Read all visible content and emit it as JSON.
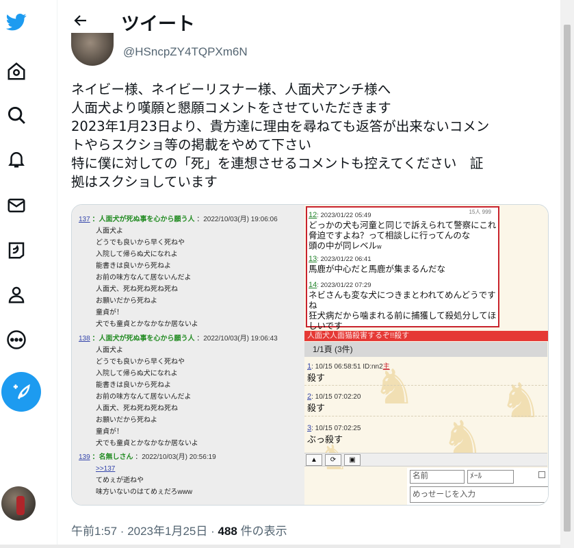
{
  "header": {
    "title": "ツイート"
  },
  "author": {
    "handle": "@HSncpZY4TQPXm6N"
  },
  "tweet": {
    "lines": [
      "ネイビー様、ネイビーリスナー様、人面犬アンチ様へ",
      "人面犬より嘆願と懇願コメントをさせていただきます",
      "2023年1月23日より、貴方達に理由を尋ねても返答が出来ないコメン",
      "トやらスクショ等の掲載をやめて下さい",
      "特に僕に対しての「死」を連想させるコメントも控えてください　証",
      "拠はスクショしています"
    ],
    "time": "午前1:57 · 2023年1月25日 · ",
    "views_count": "488",
    "views_label": " 件の表示"
  },
  "media": {
    "left_posts": [
      {
        "num": "137",
        "name": "：人面犬が死ぬ事を心から願う人",
        "date": "：2022/10/03(月) 19:06:06",
        "lines": [
          "人面犬よ",
          "どうでも良いから早く死ねや",
          "入院して帰らぬ犬になれよ",
          "能書きは良いから死ねよ",
          "お前の味方なんて居ないんだよ",
          "人面犬、死ね死ね死ね死ね",
          "お願いだから死ねよ",
          "童貞が！",
          "犬でも童貞とかなかなか居ないよ"
        ]
      },
      {
        "num": "138",
        "name": "：人面犬が死ぬ事を心から願う人",
        "date": "：2022/10/03(月) 19:06:43",
        "lines": [
          "人面犬よ",
          "どうでも良いから早く死ねや",
          "入院して帰らぬ犬になれよ",
          "能書きは良いから死ねよ",
          "お前の味方なんて居ないんだよ",
          "人面犬、死ね死ね死ね死ね",
          "お願いだから死ねよ",
          "童貞が！",
          "犬でも童貞とかなかなか居ないよ"
        ]
      },
      {
        "num": "139",
        "name": "：名無しさん",
        "date": "：2022/10/03(月) 20:56:19",
        "reply": ">>137",
        "lines": [
          "てめぇが逝ねや",
          "味方いないのはてめぇだろwww"
        ]
      }
    ],
    "right_top": {
      "counter": "15人 999",
      "posts": [
        {
          "num": "12",
          "date": ": 2023/01/22 05:49",
          "lines": [
            "どっかの犬も河童と同じで訴えられて警察にこれ",
            "脅迫ですよね？って相談しに行ってんのな",
            "頭の中が同レベル"
          ],
          "tail": "w"
        },
        {
          "num": "13",
          "date": ": 2023/01/22 06:41",
          "lines": [
            "馬鹿が中心だと馬鹿が集まるんだな"
          ]
        },
        {
          "num": "14",
          "date": ": 2023/01/22 07:29",
          "lines": [
            "ネビさんも変な犬につきまとわれてめんどうです",
            "ね",
            "狂犬病だから噛まれる前に捕獲して殺処分してほ",
            "しいです"
          ]
        }
      ]
    },
    "red_bar": "人面犬人面猫殺害するぞ!!殺す",
    "page_bar": "1/1頁 (3件)",
    "chat_posts": [
      {
        "num": "1",
        "time": ": 10/15 06:58:51 ID:nn2",
        "mark": "主",
        "body": "殺す"
      },
      {
        "num": "2",
        "time": ": 10/15 07:02:20",
        "body": "殺す"
      },
      {
        "num": "3",
        "time": ": 10/15 07:02:25",
        "body": "ぶっ殺す"
      }
    ],
    "toolbar": {
      "up": "▲",
      "refresh": "⟳",
      "image": "▣"
    },
    "form": {
      "name_placeholder": "名前",
      "mail_placeholder": "ﾒｰﾙ",
      "message_placeholder": "めっせーじを入力"
    }
  },
  "colors": {
    "accent": "#1d9bf0",
    "red_bar": "#e53935",
    "highlight_border": "#c8222c"
  },
  "icons": {
    "nav": [
      "twitter-logo-icon",
      "home-icon",
      "search-icon",
      "bell-icon",
      "mail-icon",
      "twitter-blue-icon",
      "profile-icon",
      "more-icon",
      "compose-icon"
    ]
  }
}
